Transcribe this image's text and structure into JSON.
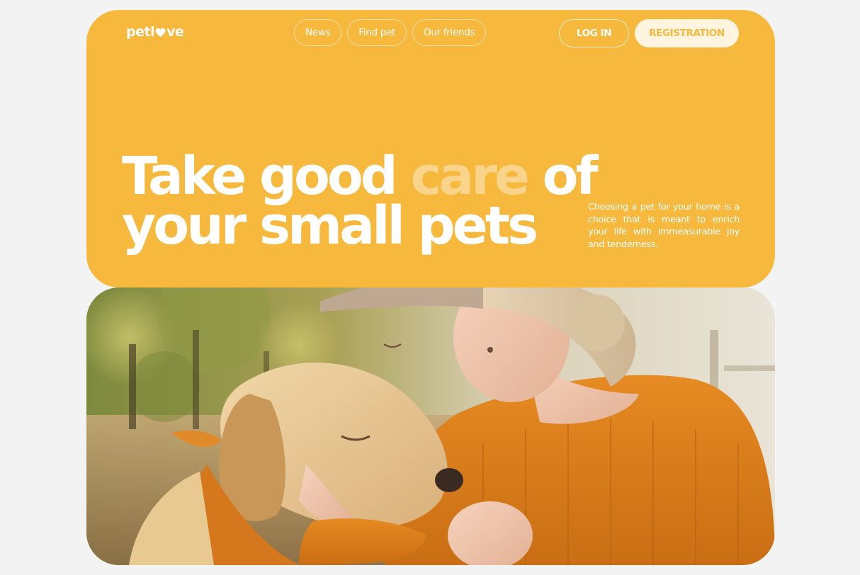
{
  "brand": {
    "logo_prefix": "petl",
    "logo_suffix": "ve",
    "logo_icon": "heart-icon"
  },
  "nav": {
    "items": [
      {
        "label": "News"
      },
      {
        "label": "Find pet"
      },
      {
        "label": "Our friends"
      }
    ]
  },
  "auth": {
    "login_label": "LOG IN",
    "register_label": "REGISTRATION"
  },
  "hero": {
    "title_part1": "Take good ",
    "title_accent": "care",
    "title_part2": " of",
    "title_line2": "your small pets",
    "description": "Choosing a pet for your home is a choice that is meant to enrich your life with immeasurable joy and tenderness."
  },
  "photo": {
    "alt": "Woman in orange sweater kissing a golden retriever dog outdoors"
  },
  "colors": {
    "brand_yellow": "#f6b83d",
    "page_background": "#f3f3f3",
    "register_button_bg": "#fff4df"
  }
}
